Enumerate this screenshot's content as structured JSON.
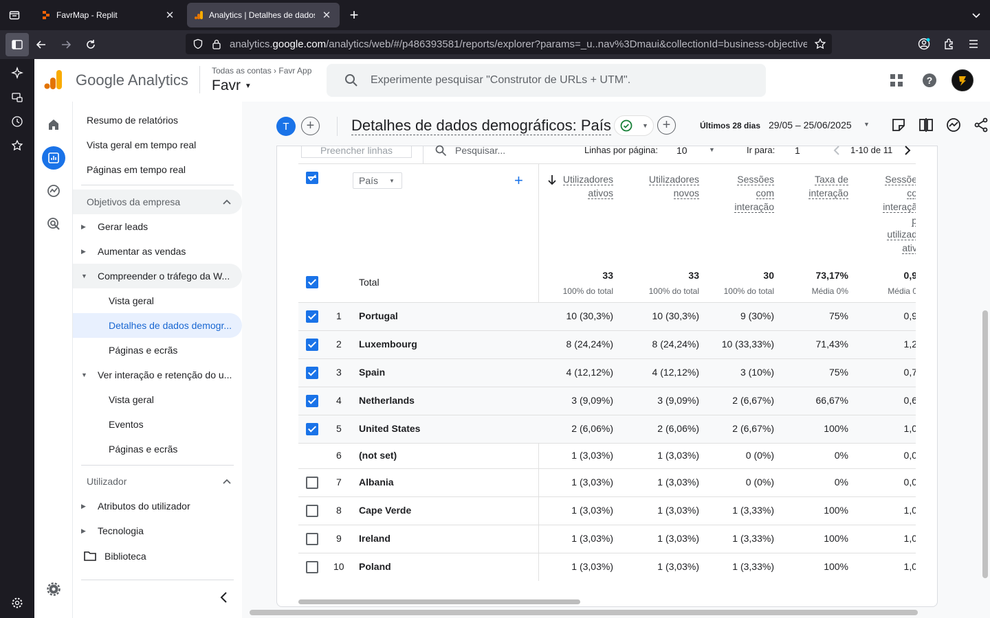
{
  "browser": {
    "tabs": [
      {
        "title": "FavrMap - Replit",
        "active": false
      },
      {
        "title": "Analytics | Detalhes de dados d",
        "active": true
      }
    ],
    "url_prefix": "analytics.",
    "url_domain": "google.com",
    "url_rest": "/analytics/web/#/p486393581/reports/explorer?params=_u..nav%3Dmaui&collectionId=business-objectives&r="
  },
  "ga": {
    "brand": "Google Analytics",
    "breadcrumb": "Todas as contas › Favr App",
    "property": "Favr",
    "search_placeholder": "Experimente pesquisar \"Construtor de URLs + UTM\"."
  },
  "menu": {
    "top_items": [
      "Resumo de relatórios",
      "Vista geral em tempo real",
      "Páginas em tempo real"
    ],
    "section1": "Objetivos da empresa",
    "gerar_leads": "Gerar leads",
    "aumentar_vendas": "Aumentar as vendas",
    "compreender": "Compreender o tráfego da W...",
    "vista_geral": "Vista geral",
    "detalhes": "Detalhes de dados demogr...",
    "paginas": "Páginas e ecrãs",
    "ver_interacao": "Ver interação e retenção do u...",
    "vista_geral2": "Vista geral",
    "eventos": "Eventos",
    "paginas2": "Páginas e ecrãs",
    "section2": "Utilizador",
    "atributos": "Atributos do utilizador",
    "tecnologia": "Tecnologia",
    "biblioteca": "Biblioteca"
  },
  "report": {
    "avatar_letter": "T",
    "title": "Detalhes de dados demográficos: País",
    "date_label": "Últimos 28 dias",
    "date_range": "29/05 – 25/06/2025"
  },
  "toolbar": {
    "fill_rows": "Preencher linhas",
    "search": "Pesquisar...",
    "rows_per_page_label": "Linhas por página:",
    "rows_per_page": "10",
    "goto_label": "Ir para:",
    "goto_value": "1",
    "pagination": "1-10 de 11"
  },
  "table": {
    "dimension": "País",
    "headers": [
      [
        "Utilizadores",
        "ativos"
      ],
      [
        "Utilizadores",
        "novos"
      ],
      [
        "Sessões",
        "com",
        "interação"
      ],
      [
        "Taxa de",
        "interação"
      ],
      [
        "Sessõe",
        "co",
        "interaçã",
        "p",
        "utilizad",
        "ativ"
      ]
    ],
    "total_label": "Total",
    "totals": [
      "33",
      "33",
      "30",
      "73,17%",
      "0,9"
    ],
    "totals_sub": [
      "100% do total",
      "100% do total",
      "100% do total",
      "Média 0%",
      "Média 0"
    ],
    "rows": [
      {
        "idx": "1",
        "country": "Portugal",
        "checked": true,
        "vals": [
          "10 (30,3%)",
          "10 (30,3%)",
          "9 (30%)",
          "75%",
          "0,9"
        ]
      },
      {
        "idx": "2",
        "country": "Luxembourg",
        "checked": true,
        "vals": [
          "8 (24,24%)",
          "8 (24,24%)",
          "10 (33,33%)",
          "71,43%",
          "1,2"
        ]
      },
      {
        "idx": "3",
        "country": "Spain",
        "checked": true,
        "vals": [
          "4 (12,12%)",
          "4 (12,12%)",
          "3 (10%)",
          "75%",
          "0,7"
        ]
      },
      {
        "idx": "4",
        "country": "Netherlands",
        "checked": true,
        "vals": [
          "3 (9,09%)",
          "3 (9,09%)",
          "2 (6,67%)",
          "66,67%",
          "0,6"
        ]
      },
      {
        "idx": "5",
        "country": "United States",
        "checked": true,
        "vals": [
          "2 (6,06%)",
          "2 (6,06%)",
          "2 (6,67%)",
          "100%",
          "1,0"
        ]
      },
      {
        "idx": "6",
        "country": "(not set)",
        "checked": null,
        "vals": [
          "1 (3,03%)",
          "1 (3,03%)",
          "0 (0%)",
          "0%",
          "0,0"
        ]
      },
      {
        "idx": "7",
        "country": "Albania",
        "checked": false,
        "vals": [
          "1 (3,03%)",
          "1 (3,03%)",
          "0 (0%)",
          "0%",
          "0,0"
        ]
      },
      {
        "idx": "8",
        "country": "Cape Verde",
        "checked": false,
        "vals": [
          "1 (3,03%)",
          "1 (3,03%)",
          "1 (3,33%)",
          "100%",
          "1,0"
        ]
      },
      {
        "idx": "9",
        "country": "Ireland",
        "checked": false,
        "vals": [
          "1 (3,03%)",
          "1 (3,03%)",
          "1 (3,33%)",
          "100%",
          "1,0"
        ]
      },
      {
        "idx": "10",
        "country": "Poland",
        "checked": false,
        "vals": [
          "1 (3,03%)",
          "1 (3,03%)",
          "1 (3,33%)",
          "100%",
          "1,0"
        ]
      }
    ]
  },
  "colors": {
    "accent": "#1a73e8",
    "ga_orange": "#f9ab00",
    "ga_dark_orange": "#e37400"
  }
}
